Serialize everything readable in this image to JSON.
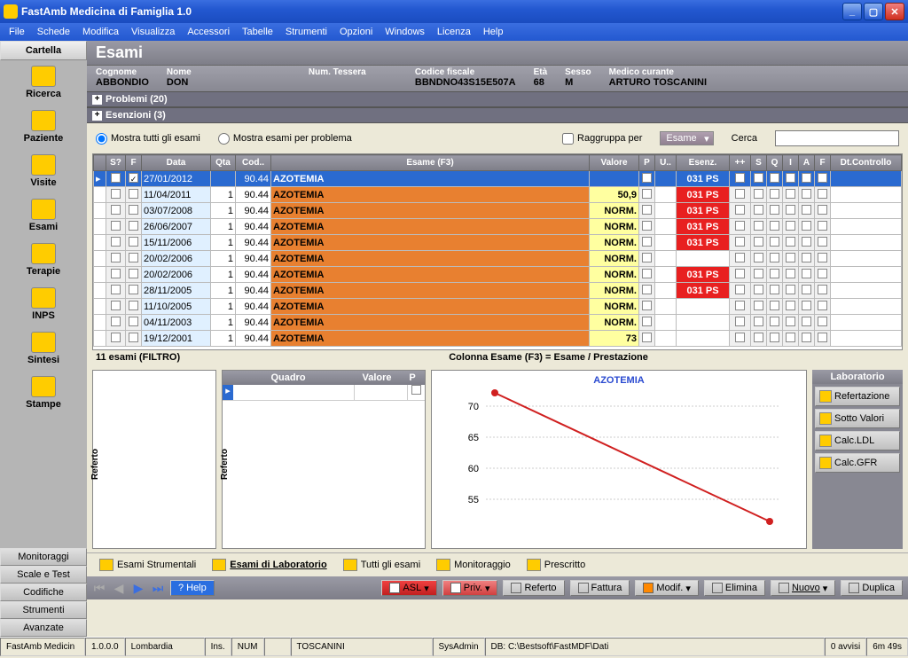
{
  "window": {
    "title": "FastAmb Medicina di Famiglia 1.0"
  },
  "menu": [
    "File",
    "Schede",
    "Modifica",
    "Visualizza",
    "Accessori",
    "Tabelle",
    "Strumenti",
    "Opzioni",
    "Windows",
    "Licenza",
    "Help"
  ],
  "sidebar": {
    "topTab": "Cartella",
    "items": [
      {
        "label": "Ricerca"
      },
      {
        "label": "Paziente"
      },
      {
        "label": "Visite"
      },
      {
        "label": "Esami"
      },
      {
        "label": "Terapie"
      },
      {
        "label": "INPS"
      },
      {
        "label": "Sintesi"
      },
      {
        "label": "Stampe"
      }
    ],
    "bottomTabs": [
      "Monitoraggi",
      "Scale e Test",
      "Codifiche",
      "Strumenti",
      "Avanzate"
    ]
  },
  "panel": {
    "title": "Esami"
  },
  "patient": {
    "cognome_lbl": "Cognome",
    "cognome": "ABBONDIO",
    "nome_lbl": "Nome",
    "nome": "DON",
    "tessera_lbl": "Num. Tessera",
    "tessera": "",
    "cf_lbl": "Codice fiscale",
    "cf": "BBNDNO43S15E507A",
    "eta_lbl": "Età",
    "eta": "68",
    "sesso_lbl": "Sesso",
    "sesso": "M",
    "medico_lbl": "Medico curante",
    "medico": "ARTURO TOSCANINI"
  },
  "collapsers": {
    "problemi": "Problemi (20)",
    "esenzioni": "Esenzioni (3)"
  },
  "filters": {
    "all": "Mostra tutti gli esami",
    "perprob": "Mostra esami per problema",
    "group": "Raggruppa per",
    "groupval": "Esame",
    "search": "Cerca"
  },
  "columns": [
    "",
    "S?",
    "F",
    "Data",
    "Qta",
    "Cod..",
    "Esame (F3)",
    "Valore",
    "P",
    "U..",
    "Esenz.",
    "++",
    "S",
    "Q",
    "I",
    "A",
    "F",
    "Dt.Controllo"
  ],
  "rows": [
    {
      "sel": true,
      "f": true,
      "date": "27/01/2012",
      "qta": "",
      "cod": "90.44",
      "exam": "AZOTEMIA",
      "val": "",
      "esen": "031 PS"
    },
    {
      "date": "11/04/2011",
      "qta": "1",
      "cod": "90.44",
      "exam": "AZOTEMIA",
      "val": "50,9",
      "esen": "031 PS"
    },
    {
      "date": "03/07/2008",
      "qta": "1",
      "cod": "90.44",
      "exam": "AZOTEMIA",
      "val": "NORM.",
      "esen": "031 PS"
    },
    {
      "date": "26/06/2007",
      "qta": "1",
      "cod": "90.44",
      "exam": "AZOTEMIA",
      "val": "NORM.",
      "esen": "031 PS"
    },
    {
      "date": "15/11/2006",
      "qta": "1",
      "cod": "90.44",
      "exam": "AZOTEMIA",
      "val": "NORM.",
      "esen": "031 PS"
    },
    {
      "date": "20/02/2006",
      "qta": "1",
      "cod": "90.44",
      "exam": "AZOTEMIA",
      "val": "NORM.",
      "esen": ""
    },
    {
      "date": "20/02/2006",
      "qta": "1",
      "cod": "90.44",
      "exam": "AZOTEMIA",
      "val": "NORM.",
      "esen": "031 PS"
    },
    {
      "date": "28/11/2005",
      "qta": "1",
      "cod": "90.44",
      "exam": "AZOTEMIA",
      "val": "NORM.",
      "esen": "031 PS"
    },
    {
      "date": "11/10/2005",
      "qta": "1",
      "cod": "90.44",
      "exam": "AZOTEMIA",
      "val": "NORM.",
      "esen": ""
    },
    {
      "date": "04/11/2003",
      "qta": "1",
      "cod": "90.44",
      "exam": "AZOTEMIA",
      "val": "NORM.",
      "esen": ""
    },
    {
      "date": "19/12/2001",
      "qta": "1",
      "cod": "90.44",
      "exam": "AZOTEMIA",
      "val": "73",
      "esen": ""
    }
  ],
  "countbar": "11 esami (FILTRO)",
  "colhint": "Colonna Esame (F3) = Esame / Prestazione",
  "quadro": {
    "h1": "Quadro",
    "h2": "Valore",
    "h3": "P"
  },
  "referto": "Referto",
  "chart_data": {
    "type": "line",
    "title": "AZOTEMIA",
    "x": [
      0,
      1
    ],
    "y": [
      73,
      50.9
    ],
    "yticks": [
      55,
      60,
      65,
      70
    ],
    "ylim": [
      50,
      75
    ]
  },
  "lab": {
    "title": "Laboratorio",
    "b1": "Refertazione",
    "b2": "Sotto Valori",
    "b3": "Calc.LDL",
    "b4": "Calc.GFR"
  },
  "tabs": {
    "t1": "Esami Strumentali",
    "t2": "Esami di Laboratorio",
    "t3": "Tutti gli esami",
    "t4": "Monitoraggio",
    "t5": "Prescritto"
  },
  "toolbar": {
    "help": "Help",
    "asl": "ASL",
    "priv": "Priv.",
    "referto": "Referto",
    "fattura": "Fattura",
    "modif": "Modif.",
    "elimina": "Elimina",
    "nuovo": "Nuovo",
    "duplica": "Duplica"
  },
  "status": {
    "app": "FastAmb Medicin",
    "ver": "1.0.0.0",
    "reg": "Lombardia",
    "ins": "Ins.",
    "num": "NUM",
    "user": "TOSCANINI",
    "role": "SysAdmin",
    "db": "DB: C:\\Bestsoft\\FastMDF\\Dati",
    "avvisi": "0 avvisi",
    "time": "6m 49s"
  }
}
